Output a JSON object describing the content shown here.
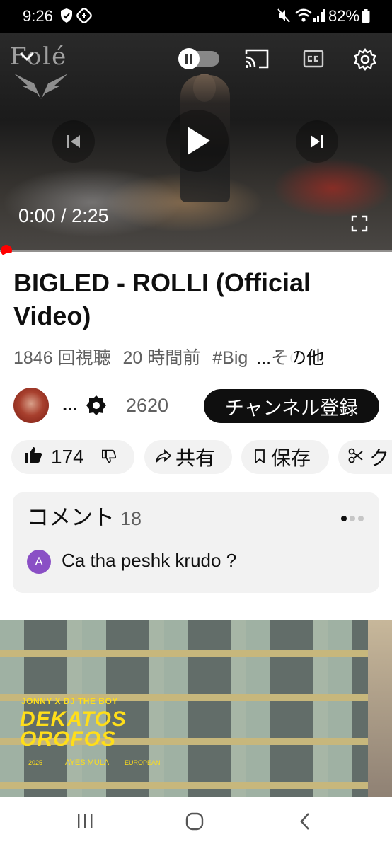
{
  "status_bar": {
    "time": "9:26",
    "battery": "82%",
    "icons": [
      "shield-icon",
      "sync-icon",
      "mute-icon",
      "wifi-icon",
      "signal-icon",
      "battery-icon"
    ]
  },
  "player": {
    "logo_text": "Folé",
    "time_current": "0:00",
    "time_total": "2:25",
    "time_display": "0:00 / 2:25",
    "progress_fraction": 0.0,
    "controls": [
      "collapse-icon",
      "autoplay-toggle",
      "cast-icon",
      "captions-icon",
      "settings-icon",
      "previous-icon",
      "play-icon",
      "next-icon",
      "fullscreen-icon"
    ]
  },
  "video": {
    "title": "BIGLED - ROLLI (Official Video)",
    "views": "1846 回視聴",
    "age": "20 時間前",
    "hashtag": "#Big",
    "more": "...その他"
  },
  "channel": {
    "name": "...",
    "subscribers": "2620",
    "subscribe_label": "チャンネル登録"
  },
  "actions": {
    "likes": "174",
    "share_label": "共有",
    "save_label": "保存",
    "clip_label": "ク"
  },
  "comments": {
    "header": "コメント",
    "count": "18",
    "top_comment": {
      "avatar_letter": "A",
      "text": "Ca tha peshk krudo ?"
    }
  },
  "next_video": {
    "overlay_small": "JONNY X DJ THE BOY",
    "overlay_title_line1": "DEKATOS",
    "overlay_title_line2": "OROFOS",
    "credit_name": "AYES MULA",
    "laurel_left": "2025",
    "laurel_right": "EUROPEAN"
  },
  "colors": {
    "accent": "#ff0000",
    "subscribe_bg": "#0f0f0f",
    "chip_bg": "#f2f2f2",
    "comment_avatar": "#8a4fc5"
  }
}
